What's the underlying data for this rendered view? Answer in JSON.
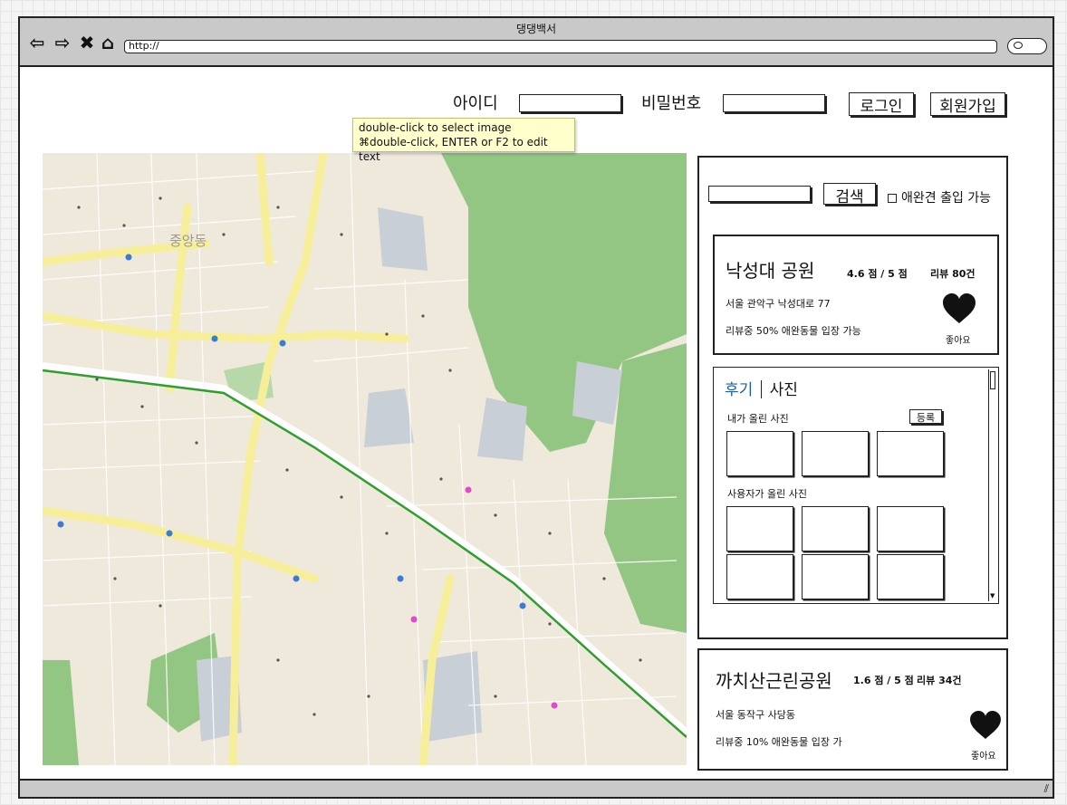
{
  "window": {
    "title": "댕댕백서",
    "url": "http://"
  },
  "login": {
    "id_label": "아이디",
    "password_label": "비밀번호",
    "login_button": "로그인",
    "signup_button": "회원가입"
  },
  "tooltip": {
    "line1": "double-click to select image",
    "line2": "⌘double-click, ENTER or F2 to edit text"
  },
  "map": {
    "district_label": "중앙동"
  },
  "search": {
    "button_label": "검색",
    "pet_filter_label": "애완견 출입 가능"
  },
  "place_selected": {
    "name": "낙성대 공원",
    "rating": "4.6 점 / 5 점",
    "reviews": "리뷰 80건",
    "address": "서울 관악구 낙성대로 77",
    "pet_note": "리뷰중 50% 애완동물 입장 가능",
    "like_label": "좋아요"
  },
  "review_tabs": {
    "tab_review": "후기",
    "tab_photo": "사진",
    "my_photos_label": "내가 올린 사진",
    "register_button": "등록",
    "user_photos_label": "사용자가 올린 사진"
  },
  "place_second": {
    "name": "까치산근린공원",
    "rating": "1.6 점 / 5 점",
    "reviews": "리뷰 34건",
    "address": "서울 동작구 사당동",
    "pet_note": "리뷰중 10% 애완동물 입장 가",
    "like_label": "좋아요"
  },
  "colors": {
    "accent_tab": "#1f5fa8",
    "map_park": "#93c683",
    "map_road": "#f7ee9a",
    "metro_line": "#2f9e2f",
    "tooltip_bg": "#ffffcc"
  },
  "icons": [
    "back-icon",
    "forward-icon",
    "close-icon",
    "home-icon",
    "search-icon",
    "heart-icon",
    "resize-grip-icon"
  ]
}
